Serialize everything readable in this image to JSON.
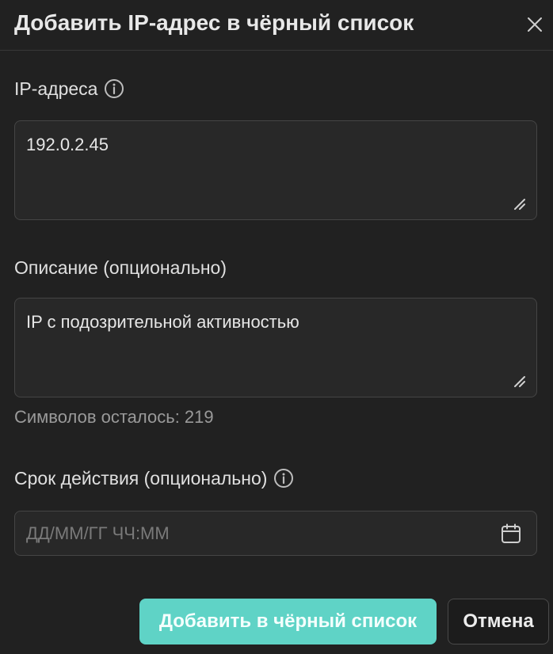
{
  "dialog": {
    "title": "Добавить IP-адрес в чёрный список",
    "close_icon": "close-icon"
  },
  "ip_field": {
    "label": "IP-адреса",
    "info_icon": "info-icon",
    "value": "192.0.2.45"
  },
  "description_field": {
    "label": "Описание (опционально)",
    "value": "IP с подозрительной активностью",
    "chars_left": "Символов осталось: 219"
  },
  "expiry_field": {
    "label": "Срок действия (опционально)",
    "info_icon": "info-icon",
    "placeholder": "ДД/ММ/ГГ ЧЧ:ММ",
    "calendar_icon": "calendar-icon"
  },
  "actions": {
    "add_label": "Добавить в чёрный список",
    "cancel_label": "Отмена"
  },
  "colors": {
    "background": "#212121",
    "accent": "#5fd3c6",
    "field_background": "#282828",
    "border": "#454545"
  }
}
